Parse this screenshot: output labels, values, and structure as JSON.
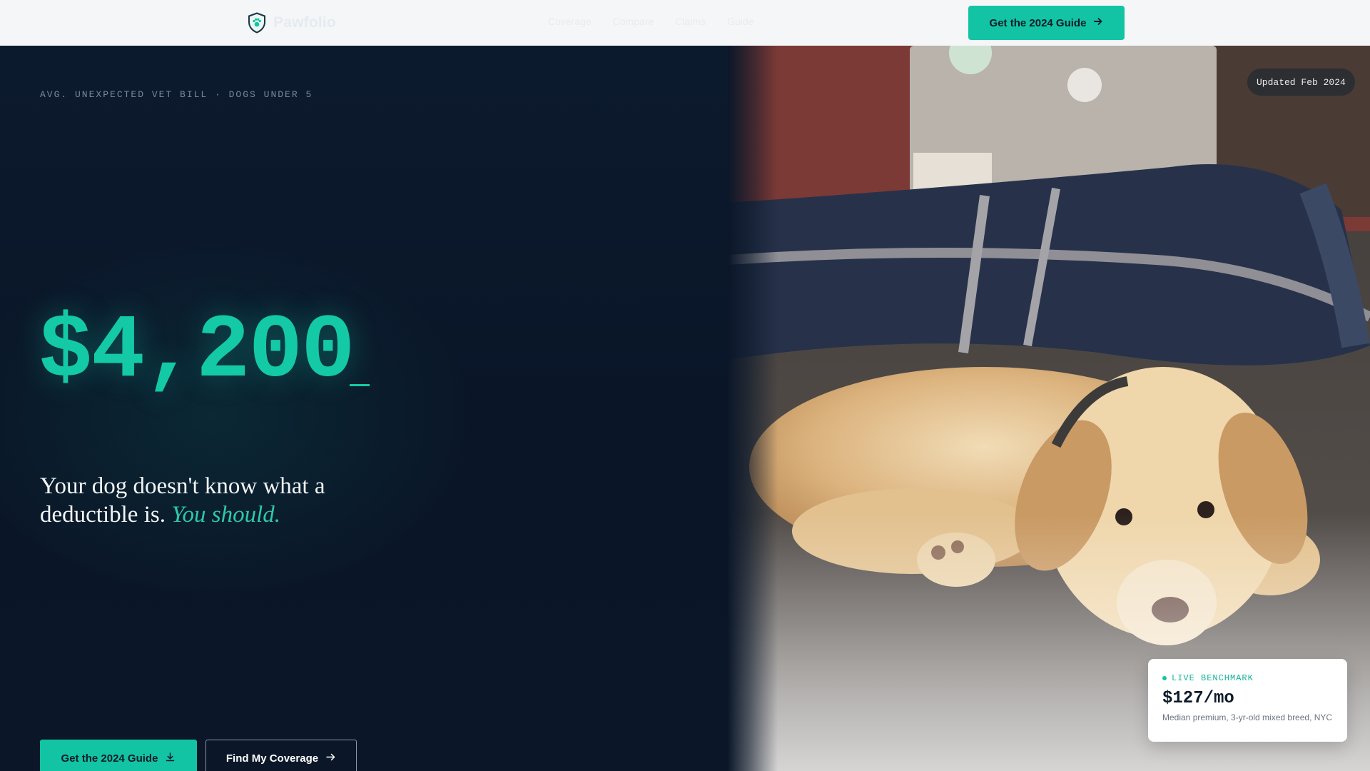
{
  "header": {
    "brand": "Pawfolio",
    "nav": [
      "Coverage",
      "Compare",
      "Claims",
      "Guide"
    ],
    "cta_label": "Get the 2024 Guide"
  },
  "hero": {
    "eyebrow": "AVG. UNEXPECTED VET BILL · DOGS UNDER 5",
    "big_number": "$4,200",
    "tagline_main": "Your dog doesn't know what a deductible is.",
    "tagline_accent": "You should.",
    "primary_button": "Get the 2024 Guide",
    "secondary_button": "Find My Coverage"
  },
  "photo": {
    "badge": "Updated Feb 2024"
  },
  "benchmark": {
    "label": "LIVE BENCHMARK",
    "value": "$127/mo",
    "note": "Median premium, 3-yr-old mixed breed, NYC"
  },
  "icons": {
    "brand": "shield-paw-icon",
    "header_cta": "arrow-right-icon",
    "primary": "download-icon",
    "secondary": "arrow-right-icon"
  },
  "colors": {
    "accent": "#12c4a3",
    "hero_bg": "#0b1729",
    "header_bg": "#f4f6f8"
  }
}
